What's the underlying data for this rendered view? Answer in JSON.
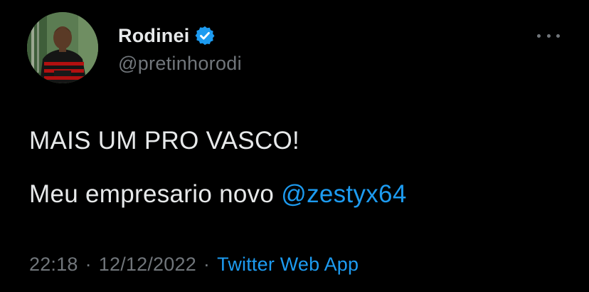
{
  "author": {
    "display_name": "Rodinei",
    "handle": "@pretinhorodi",
    "verified": true,
    "verified_icon": "verified-badge-icon",
    "avatar_icon": "profile-photo"
  },
  "tweet": {
    "line1": "MAIS UM PRO VASCO!",
    "line2_text": "Meu empresario novo ",
    "line2_mention": "@zestyx64"
  },
  "meta": {
    "time": "22:18",
    "separator": "·",
    "date": "12/12/2022",
    "source": "Twitter Web App"
  },
  "more_icon": "more-options-icon",
  "colors": {
    "background": "#000000",
    "primary_text": "#e7e9ea",
    "secondary_text": "#71767b",
    "accent": "#1d9bf0"
  }
}
